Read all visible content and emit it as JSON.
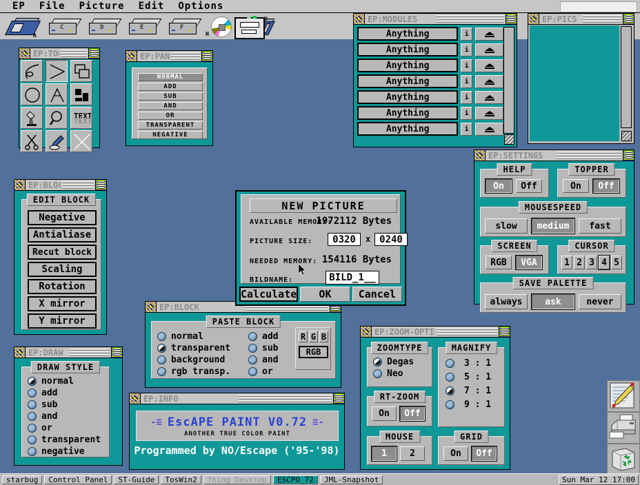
{
  "menubar": {
    "items": [
      "EP",
      "File",
      "Picture",
      "Edit",
      "Options"
    ],
    "search_value": ""
  },
  "desktop_icons": [
    {
      "label": "A",
      "type": "floppy-icon"
    },
    {
      "label": "C",
      "type": "harddisk-icon"
    },
    {
      "label": "D",
      "type": "harddisk-icon"
    },
    {
      "label": "E",
      "type": "harddisk-icon"
    },
    {
      "label": "F",
      "type": "harddisk-icon"
    },
    {
      "label": "H",
      "type": "cdrom-icon"
    },
    {
      "label": "",
      "type": "scsi-drive-icon"
    },
    {
      "label": "U",
      "type": "printer-icon"
    }
  ],
  "right_icons": [
    {
      "name": "notepad-icon"
    },
    {
      "name": "printer-icon"
    },
    {
      "name": "recycle-bin-icon"
    }
  ],
  "windows": {
    "tool": {
      "title": "EP:TOO",
      "tools": [
        "freehand-icon",
        "line-icon",
        "rectangle-icon",
        "circle-icon",
        "polygon-icon",
        "fill-icon",
        "airbrush-icon",
        "magnifier-icon",
        "text-icon",
        "scissors-icon",
        "pipette-icon",
        "cancel-icon"
      ],
      "selected_index": 1
    },
    "panel": {
      "title": "EP:PANEL",
      "items": [
        "NORMAL",
        "ADD",
        "SUB",
        "AND",
        "OR",
        "TRANSPARENT",
        "NEGATIVE"
      ],
      "selected": "NORMAL"
    },
    "modules": {
      "title": "EP:MODULES",
      "rows": [
        {
          "label": "Anything",
          "info": "i",
          "eject": "eject-icon"
        },
        {
          "label": "Anything",
          "info": "i",
          "eject": "eject-icon"
        },
        {
          "label": "Anything",
          "info": "i",
          "eject": "eject-icon"
        },
        {
          "label": "Anything",
          "info": "i",
          "eject": "eject-icon"
        },
        {
          "label": "Anything",
          "info": "i",
          "eject": "eject-icon"
        },
        {
          "label": "Anything",
          "info": "i",
          "eject": "eject-icon"
        },
        {
          "label": "Anything",
          "info": "i",
          "eject": "eject-icon"
        }
      ]
    },
    "pics": {
      "title": "EP:PICS",
      "canvas_color": "#0f9898"
    },
    "settings": {
      "title": "EP:SETTINGS",
      "groups": [
        {
          "title": "HELP",
          "options": [
            "On",
            "Off"
          ],
          "selected": "On"
        },
        {
          "title": "TOPPER",
          "options": [
            "On",
            "Off"
          ],
          "selected": "Off"
        },
        {
          "title": "MOUSESPEED",
          "options": [
            "slow",
            "medium",
            "fast"
          ],
          "selected": "medium"
        },
        {
          "title": "SCREEN",
          "options": [
            "RGB",
            "VGA"
          ],
          "selected": "VGA"
        },
        {
          "title": "CURSOR",
          "options": [
            "1",
            "2",
            "3",
            "4",
            "5"
          ],
          "selected": "4"
        },
        {
          "title": "SAVE PALETTE",
          "options": [
            "always",
            "ask",
            "never"
          ],
          "selected": "ask"
        }
      ]
    },
    "edit_block": {
      "title": "EP:BLOCK",
      "group_title": "EDIT BLOCK",
      "buttons": [
        "Negative",
        "Antialiase",
        "Recut block",
        "Scaling",
        "Rotation",
        "X mirror",
        "Y mirror"
      ]
    },
    "paste_block": {
      "title": "EP:BLOCK",
      "group_title": "PASTE BLOCK",
      "left_options": [
        "normal",
        "transparent",
        "background",
        "rgb transp."
      ],
      "left_selected": "transparent",
      "right_options": [
        "add",
        "sub",
        "and",
        "or"
      ],
      "right_selected": "",
      "channel_buttons": [
        "R",
        "G",
        "B"
      ],
      "channel_all": "RGB"
    },
    "draw": {
      "title": "EP:DRAW",
      "group_title": "DRAW STYLE",
      "options": [
        "normal",
        "add",
        "sub",
        "and",
        "or",
        "transparent",
        "negative"
      ],
      "selected": "normal"
    },
    "info": {
      "title": "EP:INFO",
      "deco_left": "-≡",
      "deco_right": "≡-",
      "product": "EscAPE PAINT V0.72",
      "tagline": "ANOTHER TRUE COLOR PAINT",
      "credits": "Programmed by NO/Escape ('95-'98)"
    },
    "zoom_options": {
      "title": "EP:ZOOM-OPTIONS",
      "zoomtype": {
        "title": "ZOOMTYPE",
        "options": [
          "Degas",
          "Neo"
        ],
        "selected": "Degas"
      },
      "magnify": {
        "title": "MAGNIFY",
        "options": [
          "3 : 1",
          "5 : 1",
          "7 : 1",
          "9 : 1"
        ],
        "selected": "7 : 1"
      },
      "rtzoom": {
        "title": "RT-ZOOM",
        "options": [
          "On",
          "Off"
        ],
        "selected": "Off"
      },
      "mouse": {
        "title": "MOUSE",
        "options": [
          "1",
          "2"
        ],
        "selected": "1"
      },
      "grid": {
        "title": "GRID",
        "options": [
          "On",
          "Off"
        ],
        "selected": "Off"
      }
    }
  },
  "dialog_new_picture": {
    "title": "NEW PICTURE",
    "rows": [
      {
        "label": "AVAILABLE MEMORY:",
        "value": "1972112 Bytes"
      },
      {
        "label": "NEEDED MEMORY:",
        "value": "154116 Bytes"
      }
    ],
    "picture_size_label": "PICTURE SIZE:",
    "width_value": "0320",
    "separator": "x",
    "height_value": "0240",
    "bildname_label": "BILDNAME:",
    "bildname_value": "BILD_1__",
    "buttons": [
      "Calculate",
      "OK",
      "Cancel"
    ],
    "default_button": "Calculate"
  },
  "taskbar": {
    "items": [
      {
        "label": "starbug",
        "state": "normal"
      },
      {
        "label": "Control Panel",
        "state": "normal"
      },
      {
        "label": "ST-Guide",
        "state": "normal"
      },
      {
        "label": "TosWin2",
        "state": "normal"
      },
      {
        "label": "Thing Desktop",
        "state": "dim"
      },
      {
        "label": "ESCPO_72",
        "state": "active"
      },
      {
        "label": "JML-Snapshot",
        "state": "normal"
      }
    ],
    "clock": "Sun Mar 12 17:00"
  },
  "colors": {
    "desktop": "#51709b",
    "window_teal": "#0f9898",
    "gray": "#b8b8b8",
    "accent_blue": "#2a3fd0"
  }
}
